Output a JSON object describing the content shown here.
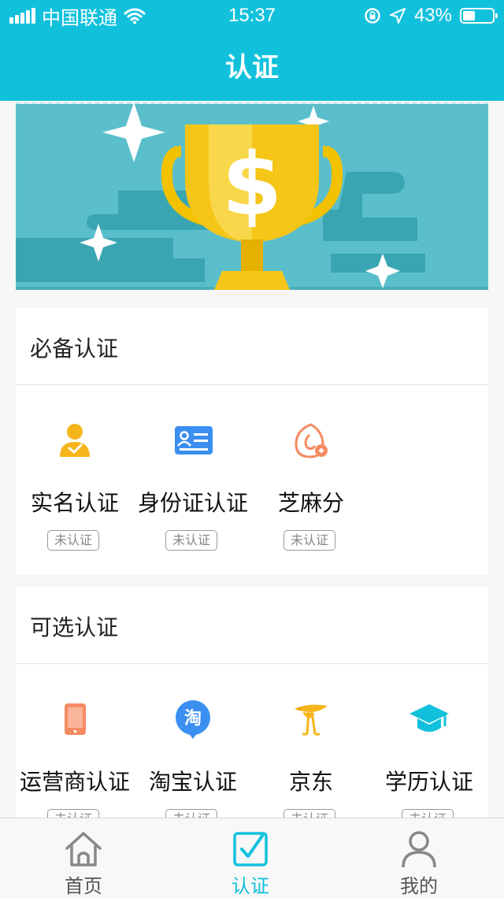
{
  "status_bar": {
    "carrier": "中国联通",
    "time": "15:37",
    "battery_text": "43%",
    "battery_level": 0.43
  },
  "header": {
    "title": "认证"
  },
  "required_section": {
    "title": "必备认证",
    "items": [
      {
        "label": "实名认证",
        "status": "未认证",
        "icon": "person-check-icon"
      },
      {
        "label": "身份证认证",
        "status": "未认证",
        "icon": "id-card-icon"
      },
      {
        "label": "芝麻分",
        "status": "未认证",
        "icon": "sesame-credit-icon"
      }
    ]
  },
  "optional_section": {
    "title": "可选认证",
    "items": [
      {
        "label": "运营商认证",
        "status": "未认证",
        "icon": "phone-icon"
      },
      {
        "label": "淘宝认证",
        "status": "未认证",
        "icon": "taobao-icon",
        "icon_text": "淘"
      },
      {
        "label": "京东",
        "status": "未认证",
        "icon": "jd-logo-icon"
      },
      {
        "label": "学历认证",
        "status": "未认证",
        "icon": "graduation-cap-icon"
      }
    ]
  },
  "tab_bar": {
    "tabs": [
      {
        "label": "首页",
        "icon": "home-icon",
        "active": false
      },
      {
        "label": "认证",
        "icon": "check-square-icon",
        "active": true
      },
      {
        "label": "我的",
        "icon": "user-icon",
        "active": false
      }
    ]
  },
  "colors": {
    "brand": "#11c1dc",
    "orange": "#f7a25f",
    "blue": "#3b8ff0",
    "yellow": "#f6b51b",
    "teal": "#5bbfcb"
  }
}
